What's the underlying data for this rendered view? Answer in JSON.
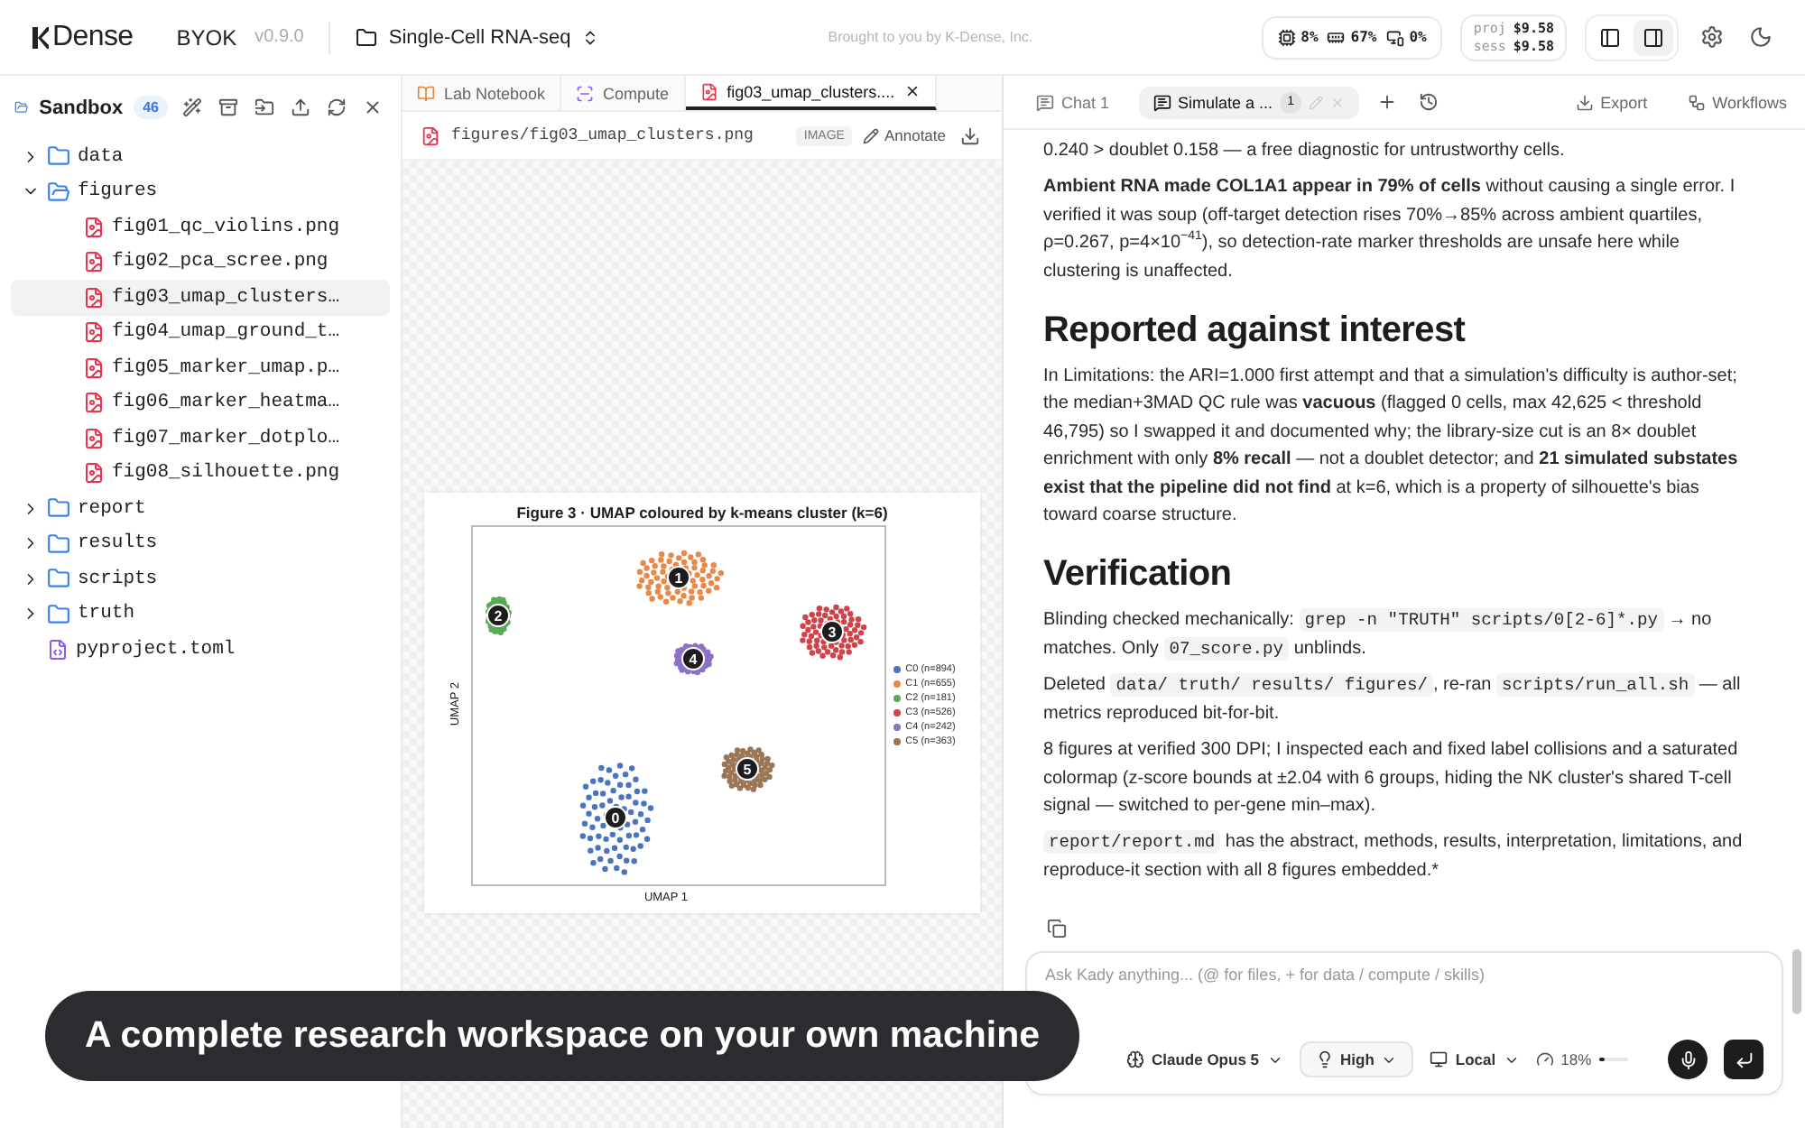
{
  "topbar": {
    "logo": "Dense",
    "edition": "BYOK",
    "version": "v0.9.0",
    "project": "Single-Cell RNA-seq",
    "credit": "Brought to you by K-Dense, Inc.",
    "stats": [
      {
        "kind": "cpu",
        "value": "8%"
      },
      {
        "kind": "memory",
        "value": "67%"
      },
      {
        "kind": "gpu",
        "value": "0%"
      }
    ],
    "costs": [
      {
        "label": "proj",
        "value": "$9.58"
      },
      {
        "label": "sess",
        "value": "$9.58"
      }
    ],
    "layout_toggles": [
      {
        "kind": "left",
        "selected": false
      },
      {
        "kind": "right",
        "selected": true
      }
    ]
  },
  "sidebar": {
    "title": "Sandbox",
    "count": "46",
    "tree": [
      {
        "kind": "folder",
        "name": "data",
        "expanded": false,
        "selected": false
      },
      {
        "kind": "folder",
        "name": "figures",
        "expanded": true,
        "selected": false,
        "children": [
          {
            "kind": "image",
            "name": "fig01_qc_violins.png",
            "selected": false
          },
          {
            "kind": "image",
            "name": "fig02_pca_scree.png",
            "selected": false
          },
          {
            "kind": "image",
            "name": "fig03_umap_clusters…",
            "selected": true
          },
          {
            "kind": "image",
            "name": "fig04_umap_ground_t…",
            "selected": false
          },
          {
            "kind": "image",
            "name": "fig05_marker_umap.p…",
            "selected": false
          },
          {
            "kind": "image",
            "name": "fig06_marker_heatma…",
            "selected": false
          },
          {
            "kind": "image",
            "name": "fig07_marker_dotplo…",
            "selected": false
          },
          {
            "kind": "image",
            "name": "fig08_silhouette.png",
            "selected": false
          }
        ]
      },
      {
        "kind": "folder",
        "name": "report",
        "expanded": false,
        "selected": false
      },
      {
        "kind": "folder",
        "name": "results",
        "expanded": false,
        "selected": false
      },
      {
        "kind": "folder",
        "name": "scripts",
        "expanded": false,
        "selected": false
      },
      {
        "kind": "folder",
        "name": "truth",
        "expanded": false,
        "selected": false
      },
      {
        "kind": "code",
        "name": "pyproject.toml",
        "selected": false
      }
    ]
  },
  "viewer": {
    "tabs": [
      {
        "kind": "notebook",
        "label": "Lab Notebook",
        "selected": false
      },
      {
        "kind": "compute",
        "label": "Compute",
        "selected": false
      },
      {
        "kind": "image",
        "label": "fig03_umap_clusters....",
        "selected": true
      }
    ],
    "path": "figures/fig03_umap_clusters.png",
    "type_badge": "IMAGE",
    "annotate": "Annotate",
    "figure": {
      "title": "Figure 3 · UMAP coloured by k-means cluster (k=6)",
      "xlabel": "UMAP 1",
      "ylabel": "UMAP 2",
      "clusters": [
        {
          "label": "0",
          "legend": "C0 (n=894)",
          "color": "#4a74c0"
        },
        {
          "label": "1",
          "legend": "C1 (n=655)",
          "color": "#e8894a"
        },
        {
          "label": "2",
          "legend": "C2 (n=181)",
          "color": "#5aa85a"
        },
        {
          "label": "3",
          "legend": "C3 (n=526)",
          "color": "#d0434a"
        },
        {
          "label": "4",
          "legend": "C4 (n=242)",
          "color": "#8c72c4"
        },
        {
          "label": "5",
          "legend": "C5 (n=363)",
          "color": "#9b7656"
        }
      ]
    }
  },
  "chat": {
    "tabs": [
      {
        "label": "Chat 1",
        "selected": false
      },
      {
        "label": "Simulate a ...",
        "badge": "1",
        "selected": true
      }
    ],
    "actions": [
      "Export",
      "Workflows"
    ],
    "blocks": [
      {
        "kind": "paragraph",
        "parts": [
          {
            "kind": "text",
            "text": "0.240 > doublet 0.158 — a free diagnostic for untrustworthy cells."
          }
        ]
      },
      {
        "kind": "paragraph",
        "parts": [
          {
            "kind": "text",
            "text": "**Ambient RNA made COL1A1 appear in 79% of cells** without causing a single error. I verified it was soup (off-target detection rises 70%→85% across ambient quartiles, ρ=0.267, p=4×10$^{−41}$), so detection-rate marker thresholds are unsafe here while clustering is unaffected."
          }
        ]
      },
      {
        "kind": "heading",
        "text": "Reported against interest"
      },
      {
        "kind": "paragraph",
        "parts": [
          {
            "kind": "text",
            "text": "In Limitations: the ARI=1.000 first attempt and that a simulation's difficulty is author-set; the median+3MAD QC rule was **vacuous** (flagged 0 cells, max 42,625 < threshold 46,795) so I swapped it and documented why; the library-size cut is an 8× doublet enrichment with only **8% recall** — not a doublet detector; and **21 simulated substates exist that the pipeline did not find** at k=6, which is a property of silhouette's bias toward coarse structure."
          }
        ]
      },
      {
        "kind": "heading",
        "text": "Verification"
      },
      {
        "kind": "paragraph",
        "parts": [
          {
            "kind": "text",
            "text": "Blinding checked mechanically: "
          },
          {
            "kind": "code",
            "text": "grep -n \"TRUTH\" scripts/0[2-6]*.py"
          },
          {
            "kind": "text",
            "text": " → no matches. Only "
          },
          {
            "kind": "code",
            "text": "07_score.py"
          },
          {
            "kind": "text",
            "text": " unblinds."
          }
        ]
      },
      {
        "kind": "paragraph",
        "parts": [
          {
            "kind": "text",
            "text": "Deleted "
          },
          {
            "kind": "code",
            "text": "data/ truth/ results/ figures/"
          },
          {
            "kind": "text",
            "text": ", re-ran "
          },
          {
            "kind": "code",
            "text": "scripts/run_all.sh"
          },
          {
            "kind": "text",
            "text": " — all metrics reproduced bit-for-bit."
          }
        ]
      },
      {
        "kind": "paragraph",
        "parts": [
          {
            "kind": "text",
            "text": "8 figures at verified 300 DPI; I inspected each and fixed label collisions and a saturated colormap (z-score bounds at ±2.04 with 6 groups, hiding the NK cluster's shared T-cell signal — switched to per-gene min–max)."
          }
        ]
      },
      {
        "kind": "paragraph",
        "parts": [
          {
            "kind": "code",
            "text": "report/report.md"
          },
          {
            "kind": "text",
            "text": " has the abstract, methods, results, interpretation, limitations, and reproduce-it section with all 8 figures embedded.*"
          }
        ]
      }
    ],
    "input": {
      "placeholder": "Ask Kady anything... (@ for files, + for data / compute / skills)",
      "model": "Claude Opus 5",
      "effort": "High",
      "runtime": "Local",
      "context": "18%",
      "level": 0.18
    }
  },
  "caption": "A complete research workspace on your own machine"
}
